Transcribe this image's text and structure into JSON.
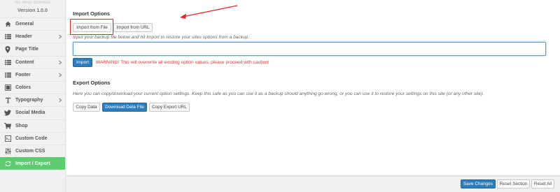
{
  "sidebar": {
    "brand_name": "We Mean Business",
    "version": "Version 1.0.0",
    "items": [
      {
        "label": "General",
        "icon": "home-icon",
        "chevron": false
      },
      {
        "label": "Header",
        "icon": "list-icon",
        "chevron": true
      },
      {
        "label": "Page Title",
        "icon": "map-pin-icon",
        "chevron": false
      },
      {
        "label": "Content",
        "icon": "list-icon",
        "chevron": true
      },
      {
        "label": "Footer",
        "icon": "list-icon",
        "chevron": true
      },
      {
        "label": "Colors",
        "icon": "swatch-icon",
        "chevron": false
      },
      {
        "label": "Typography",
        "icon": "text-icon",
        "chevron": true
      },
      {
        "label": "Social Media",
        "icon": "twitter-icon",
        "chevron": false
      },
      {
        "label": "Shop",
        "icon": "cart-icon",
        "chevron": false
      },
      {
        "label": "Custom Code",
        "icon": "code-icon",
        "chevron": false
      },
      {
        "label": "Custom CSS",
        "icon": "sliders-icon",
        "chevron": false
      },
      {
        "label": "Import / Export",
        "icon": "refresh-icon",
        "chevron": false,
        "active": true
      }
    ]
  },
  "import": {
    "title": "Import Options",
    "tab_file": "Import from File",
    "tab_url": "Import from URL",
    "description": "Input your backup file below and hit Import to restore your sites options from a backup.",
    "textarea_value": "",
    "import_button": "Import",
    "warning": "WARNING! This will overwrite all existing option values, please proceed with caution!"
  },
  "export": {
    "title": "Export Options",
    "description": "Here you can copy/download your current option settings. Keep this safe as you can use it as a backup should anything go wrong, or you can use it to restore your settings on this site (or any other site).",
    "copy_data": "Copy Data",
    "download_data": "Download Data File",
    "copy_url": "Copy Export URL"
  },
  "footer": {
    "save": "Save Changes",
    "reset_section": "Reset Section",
    "reset_all": "Reset All"
  },
  "colors": {
    "active_nav": "#5ccc6e",
    "primary_button": "#2e7dba",
    "warning": "#dd3333",
    "annotation": "#e02525"
  }
}
